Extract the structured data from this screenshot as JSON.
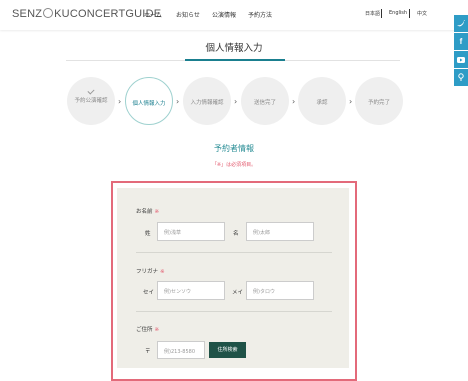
{
  "header": {
    "logo": {
      "part1": "SENZ",
      "part2": "KUCONCERTGUIDE"
    },
    "nav": [
      "ホーム",
      "お知らせ",
      "公演情報",
      "予約方法"
    ],
    "languages": [
      "日本語",
      "English",
      "中文"
    ]
  },
  "side_icons": [
    "twitter-icon",
    "facebook-icon",
    "youtube-icon",
    "map-pin-icon"
  ],
  "page": {
    "title": "個人情報入力"
  },
  "steps": [
    "予約公演確認",
    "個人情報入力",
    "入力情報確認",
    "送信完了",
    "承認",
    "予約完了"
  ],
  "active_step": "個人情報入力",
  "section": {
    "title": "予約者情報",
    "required_note": "「※」は必須項目。"
  },
  "form": {
    "name": {
      "label": "お名前",
      "req": "※",
      "sei_label": "姓",
      "sei_placeholder": "例)浅草",
      "mei_label": "名",
      "mei_placeholder": "例)太郎"
    },
    "furigana": {
      "label": "フリガナ",
      "req": "※",
      "sei_label": "セイ",
      "sei_placeholder": "例)センソウ",
      "mei_label": "メイ",
      "mei_placeholder": "例)タロウ"
    },
    "address": {
      "label": "ご住所",
      "req": "※",
      "zip_label": "〒",
      "zip_placeholder": "例)213-8580",
      "search_button": "住所検索"
    }
  },
  "colors": {
    "accent": "#1a7f8f",
    "required": "#e2576b",
    "frame": "#e36a7a",
    "button": "#1f5247",
    "side": "#2e9cc6"
  }
}
